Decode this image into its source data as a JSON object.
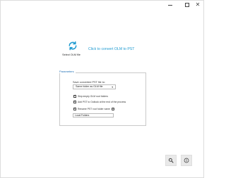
{
  "window": {
    "controls": {
      "minimize_icon": "minimize-icon",
      "maximize_icon": "maximize-icon",
      "close_label": "✕"
    }
  },
  "select_olm": {
    "icon": "sync-icon",
    "label": "Select OLM file",
    "color": "#1f9bd1"
  },
  "main": {
    "prompt": "Click to convert OLM to PST"
  },
  "parameters": {
    "legend": "Parameters",
    "save_label": "Save converted PST file to:",
    "save_option": "Same folder as OLM file",
    "options": [
      {
        "label": "Skip empty OLM root folders",
        "checked": true
      },
      {
        "label": "Add PST to Outlook at the end of the process",
        "checked": true
      },
      {
        "label": "Rename PST root folder name",
        "checked": true
      }
    ],
    "help_label": "?",
    "root_folder_name": "Local Folders"
  },
  "footer": {
    "search_icon": "search-icon",
    "info_icon": "info-icon"
  }
}
